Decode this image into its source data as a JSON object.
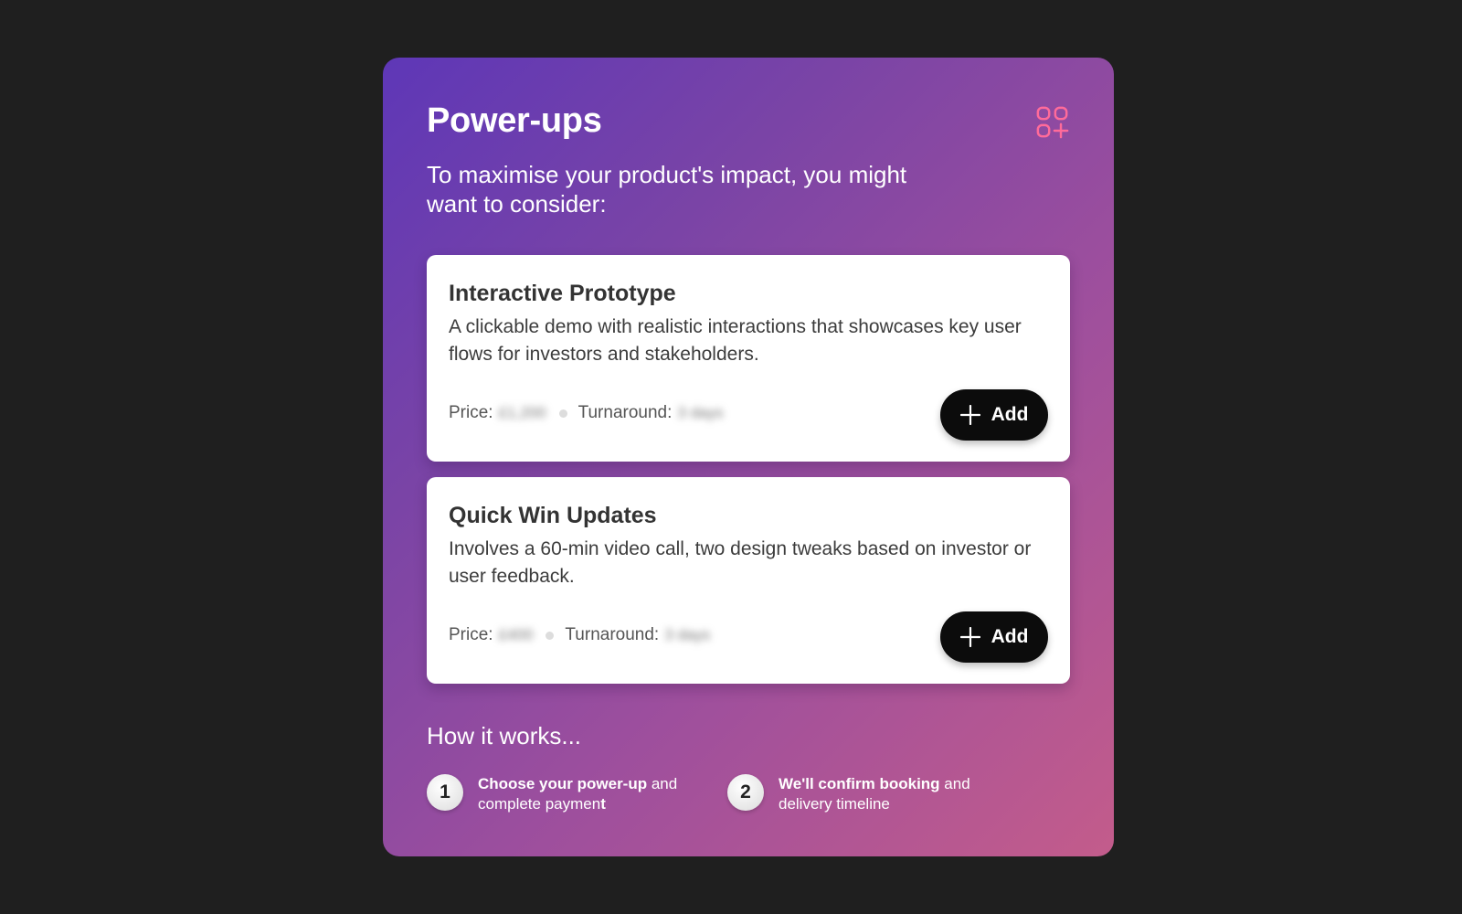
{
  "panel": {
    "title": "Power-ups",
    "subtitle": "To maximise your product's impact, you might want to consider:",
    "icon": "grid-add-icon",
    "accent_icon_color": "#ff6b9a"
  },
  "cards": [
    {
      "title": "Interactive Prototype",
      "description": "A clickable demo with realistic interactions that showcases key user flows for investors and stakeholders.",
      "price_label": "Price:",
      "price_value": "£1,200",
      "turnaround_label": "Turnaround:",
      "turnaround_value": "3 days",
      "add_label": "Add"
    },
    {
      "title": "Quick Win Updates",
      "description": "Involves a 60-min video call, two design tweaks based on investor or user feedback.",
      "price_label": "Price:",
      "price_value": "£400",
      "turnaround_label": "Turnaround:",
      "turnaround_value": "3 days",
      "add_label": "Add"
    }
  ],
  "how_it_works": {
    "title": "How it works...",
    "steps": [
      {
        "number": "1",
        "bold": "Choose your power-up",
        "rest": " and complete paymen",
        "tail": "t"
      },
      {
        "number": "2",
        "bold": "We'll confirm booking",
        "rest": " and delivery timeline",
        "tail": ""
      }
    ]
  },
  "colors": {
    "background": "#1f1f1f",
    "gradient_start": "#5e37b7",
    "gradient_end": "#c35c8b",
    "button": "#0c0c0c"
  }
}
